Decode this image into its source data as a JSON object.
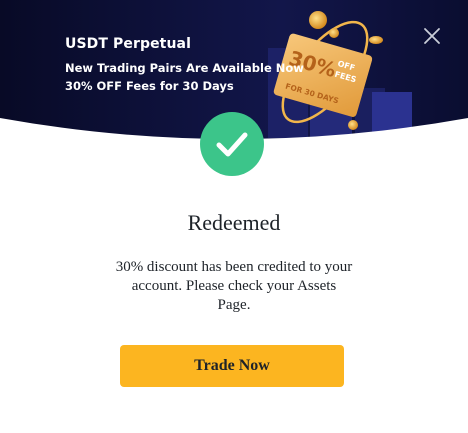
{
  "banner": {
    "title": "USDT Perpetual",
    "line1": "New Trading Pairs Are Available Now",
    "line2": "30% OFF Fees for 30 Days",
    "ticket_big": "30%",
    "ticket_off": "OFF",
    "ticket_fees": "FEES",
    "ticket_days": "FOR 30 DAYS"
  },
  "dialog": {
    "heading": "Redeemed",
    "message": "30% discount has been credited to your account. Please check your Assets Page.",
    "button_label": "Trade Now"
  },
  "icons": {
    "close": "close-icon",
    "success": "check-circle-icon"
  },
  "colors": {
    "banner_bg": "#0b0f2e",
    "accent": "#fcb520",
    "success": "#3cc58a",
    "text": "#1e2329"
  }
}
